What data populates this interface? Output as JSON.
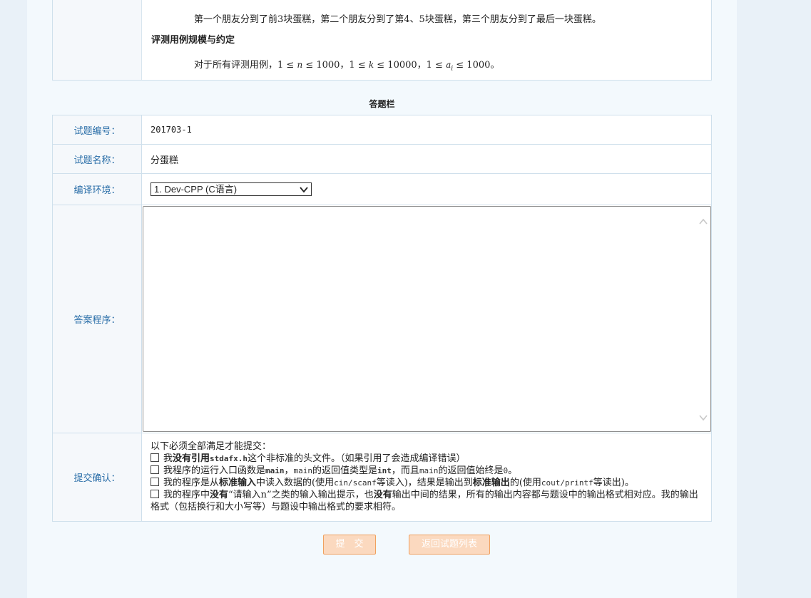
{
  "problem": {
    "example_text": "第一个朋友分到了前3块蛋糕，第二个朋友分到了第4、5块蛋糕，第三个朋友分到了最后一块蛋糕。",
    "scale_heading": "评测用例规模与约定",
    "scale_prefix": "对于所有评测用例，",
    "c1": "1 ≤ ",
    "v_n": "n",
    "c2": " ≤ 1000，1 ≤ ",
    "v_k": "k",
    "c3": " ≤ 10000，1 ≤ ",
    "v_a": "a",
    "v_a_sub": "i",
    "c4": " ≤ 1000。"
  },
  "answer": {
    "section_title": "答题栏",
    "id_label": "试题编号：",
    "id_value": "201703-1",
    "name_label": "试题名称：",
    "name_value": "分蛋糕",
    "env_label": "编译环境：",
    "env_selected": "1. Dev-CPP (C语言)",
    "code_label": "答案程序：",
    "code_value": "",
    "confirm_label": "提交确认："
  },
  "confirm": {
    "intro": "以下必须全部满足才能提交：",
    "c1": [
      "我",
      "没有引用",
      "stdafx.h",
      "这个非标准的头文件。（如果引用了会造成编译错误）"
    ],
    "c2": [
      "我程序的运行入口函数是",
      "main",
      "，",
      "main",
      "的返回值类型是",
      "int",
      "，而且",
      "main",
      "的返回值始终是",
      "0",
      "。"
    ],
    "c3": [
      "我的程序是从",
      "标准输入",
      "中读入数据的(使用",
      "cin/scanf",
      "等读入)，结果是输出到",
      "标准输出",
      "的(使用",
      "cout/printf",
      "等读出)。"
    ],
    "c4": [
      "我的程序中",
      "没有",
      "“请输入n”之类的输入输出提示，也",
      "没有",
      "输出中间的结果，所有的输出内容都与题设中的输出格式相对应。我的输出格式（包括换行和大小写等）与题设中输出格式的要求相符。"
    ]
  },
  "buttons": {
    "submit": "提　交",
    "back": "返回试题列表"
  }
}
